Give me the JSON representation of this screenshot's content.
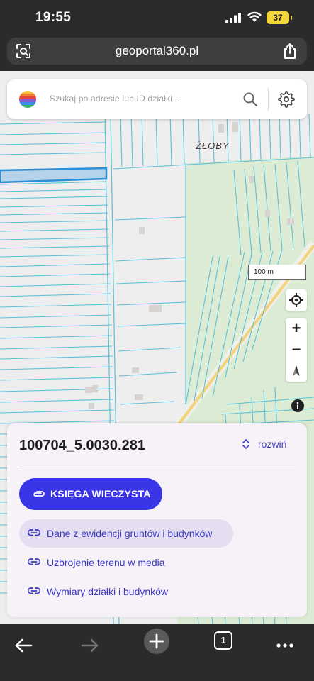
{
  "status_bar": {
    "time": "19:55",
    "battery": "37",
    "icons": [
      "signal-icon",
      "wifi-icon",
      "battery-icon"
    ]
  },
  "browser": {
    "url": "geoportal360.pl",
    "tab_count": "1",
    "icons": [
      "page-settings-icon",
      "share-icon",
      "back-icon",
      "forward-icon",
      "new-tab-icon",
      "tabs-icon",
      "more-icon"
    ]
  },
  "search": {
    "placeholder": "Szukaj po adresie lub ID działki ..."
  },
  "map": {
    "place_label": "ŻŁOBY",
    "scale_label": "100 m",
    "zoom_in": "+",
    "zoom_out": "−",
    "colors": {
      "parcel_line": "#5bc0d8",
      "selected_parcel": "#2a8fd6",
      "meadow": "#dcecd4",
      "road": "#f3d27a"
    }
  },
  "panel": {
    "parcel_id": "100704_5.0030.281",
    "expand_label": "rozwiń",
    "primary_button": "KSIĘGA WIECZYSTA",
    "links": [
      "Dane z ewidencji gruntów i budynków",
      "Uzbrojenie terenu w media",
      "Wymiary działki i budynków"
    ],
    "accent": "#3a36e8"
  }
}
